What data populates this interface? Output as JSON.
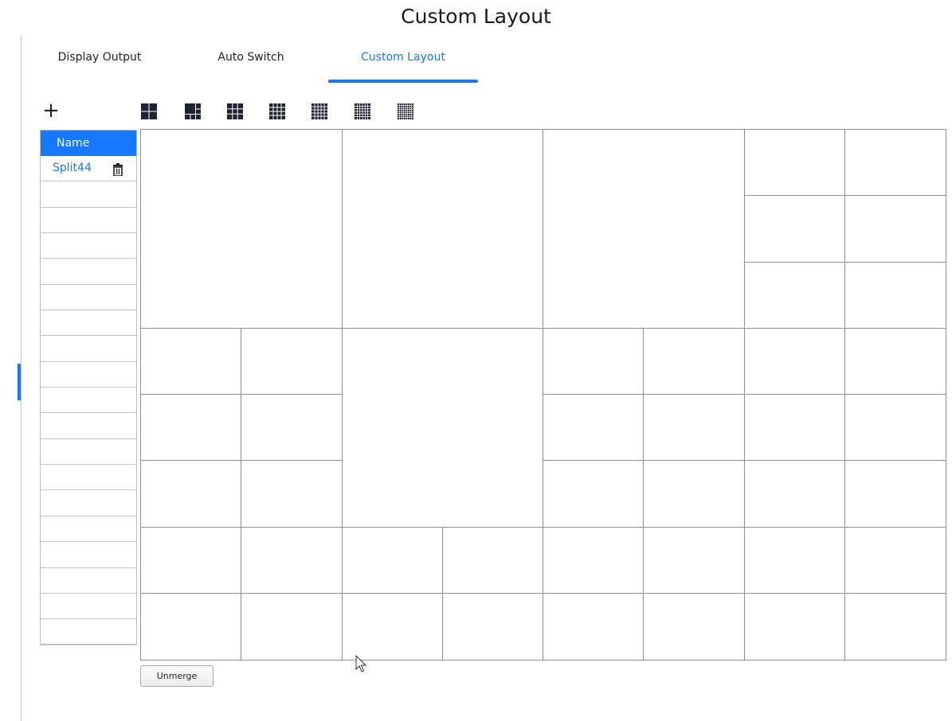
{
  "page": {
    "title": "Custom Layout"
  },
  "tabs": [
    {
      "label": "Display Output",
      "active": false
    },
    {
      "label": "Auto Switch",
      "active": false
    },
    {
      "label": "Custom Layout",
      "active": true
    }
  ],
  "toolbar": {
    "add_icon": "plus-icon",
    "presets": [
      {
        "icon": "split-4-layout-icon"
      },
      {
        "icon": "split-6-layout-icon"
      },
      {
        "icon": "split-9-layout-icon"
      },
      {
        "icon": "split-16-layout-icon"
      },
      {
        "icon": "split-25-layout-icon"
      },
      {
        "icon": "split-36-layout-icon"
      },
      {
        "icon": "split-64-layout-icon"
      }
    ]
  },
  "name_list": {
    "header": "Name",
    "rows": [
      "Split44",
      "",
      "",
      "",
      "",
      "",
      "",
      "",
      "",
      "",
      "",
      "",
      "",
      "",
      "",
      "",
      "",
      "",
      ""
    ]
  },
  "layout": {
    "columns": 8,
    "rows": 8,
    "merged_blocks": [
      {
        "col": 0,
        "row": 0,
        "colspan": 2,
        "rowspan": 3
      },
      {
        "col": 2,
        "row": 0,
        "colspan": 2,
        "rowspan": 3
      },
      {
        "col": 4,
        "row": 0,
        "colspan": 2,
        "rowspan": 3
      },
      {
        "col": 2,
        "row": 3,
        "colspan": 2,
        "rowspan": 3
      }
    ]
  },
  "buttons": {
    "unmerge": "Unmerge"
  },
  "colors": {
    "accent": "#1677ff",
    "grid_line": "#8f8f8f"
  }
}
